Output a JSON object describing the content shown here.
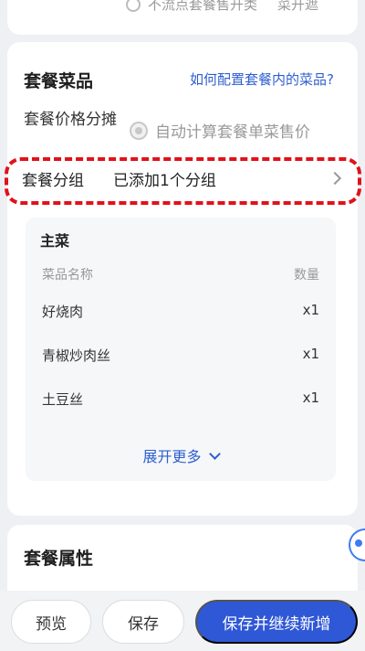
{
  "top_card": {
    "option_a": "不流点套餐售开类",
    "option_b": "菜开遮"
  },
  "dish_section": {
    "title": "套餐菜品",
    "help_link": "如何配置套餐内的菜品?",
    "price_split_label": "套餐价格分摊",
    "price_split_option": "自动计算套餐单菜售价",
    "group_label": "套餐分组",
    "group_value": "已添加1个分组",
    "group": {
      "name": "主菜",
      "column_name": "菜品名称",
      "column_qty": "数量",
      "items": [
        {
          "name": "好烧肉",
          "qty": "x1"
        },
        {
          "name": "青椒炒肉丝",
          "qty": "x1"
        },
        {
          "name": "土豆丝",
          "qty": "x1"
        }
      ],
      "expand_label": "展开更多"
    }
  },
  "attributes_section": {
    "title": "套餐属性"
  },
  "actions": {
    "preview": "预览",
    "save": "保存",
    "save_and_new": "保存并继续新增"
  },
  "colors": {
    "accent": "#2f58d6",
    "link": "#2f5fcf",
    "highlight": "#e0121a"
  }
}
